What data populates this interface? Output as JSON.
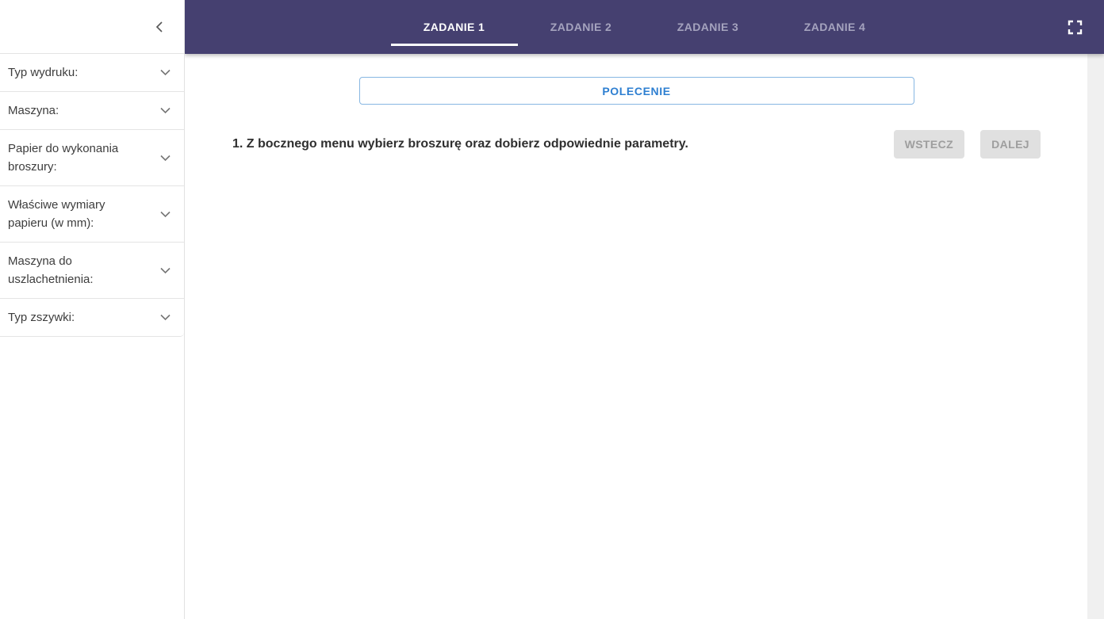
{
  "header": {
    "tabs": [
      {
        "label": "ZADANIE 1",
        "active": true
      },
      {
        "label": "ZADANIE 2",
        "active": false
      },
      {
        "label": "ZADANIE 3",
        "active": false
      },
      {
        "label": "ZADANIE 4",
        "active": false
      }
    ],
    "fullscreen_icon": "fullscreen-icon",
    "colors": {
      "background": "#454070",
      "active_tab_text": "#ffffff",
      "inactive_tab_text": "#a5a3be",
      "active_tab_underline": "#ffffff"
    }
  },
  "sidebar": {
    "collapse_icon": "chevron-left-icon",
    "items": [
      {
        "label": "Typ wydruku:",
        "icon": "chevron-down-icon",
        "expanded": false
      },
      {
        "label": "Maszyna:",
        "icon": "chevron-down-icon",
        "expanded": false
      },
      {
        "label": "Papier do wykonania broszury:",
        "icon": "chevron-down-icon",
        "expanded": false
      },
      {
        "label": "Właściwe wymiary papieru (w mm):",
        "icon": "chevron-down-icon",
        "expanded": false
      },
      {
        "label": "Maszyna do uszlachetnienia:",
        "icon": "chevron-down-icon",
        "expanded": false
      },
      {
        "label": "Typ zszywki:",
        "icon": "chevron-down-icon",
        "expanded": false
      }
    ]
  },
  "main": {
    "polecenie": {
      "label": "POLECENIE",
      "border_color": "#87b7e2",
      "text_color": "#2e7fd1"
    },
    "instruction": "1. Z bocznego menu wybierz broszurę oraz dobierz odpowiednie parametry.",
    "buttons": [
      {
        "label": "WSTECZ",
        "enabled": false
      },
      {
        "label": "DALEJ",
        "enabled": false
      }
    ]
  }
}
